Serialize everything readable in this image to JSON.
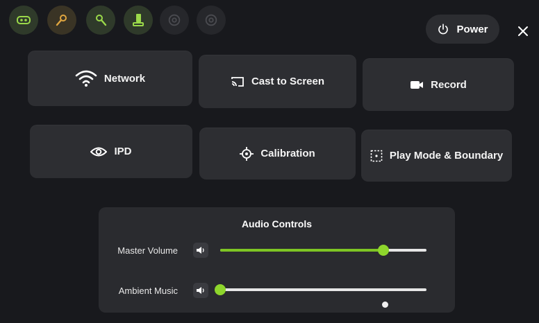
{
  "status_bar": {
    "icons": [
      {
        "name": "headset-icon",
        "state": "active"
      },
      {
        "name": "controller-left-icon",
        "state": "active"
      },
      {
        "name": "controller-right-icon",
        "state": "active"
      },
      {
        "name": "device-icon",
        "state": "active"
      },
      {
        "name": "tracker-icon",
        "state": "inactive"
      },
      {
        "name": "tracker-icon",
        "state": "inactive"
      }
    ]
  },
  "header": {
    "power_label": "Power",
    "power_icon": "power-icon",
    "close_icon": "close-icon"
  },
  "tiles": [
    {
      "label": "Network",
      "icon": "wifi-icon"
    },
    {
      "label": "Cast to Screen",
      "icon": "cast-icon"
    },
    {
      "label": "Record",
      "icon": "record-icon"
    },
    {
      "label": "IPD",
      "icon": "eye-icon"
    },
    {
      "label": "Calibration",
      "icon": "crosshair-icon"
    },
    {
      "label": "Play Mode & Boundary",
      "icon": "boundary-icon"
    }
  ],
  "audio": {
    "title": "Audio Controls",
    "sliders": [
      {
        "label": "Master Volume",
        "value": 0.79
      },
      {
        "label": "Ambient Music",
        "value": 0.0
      }
    ]
  },
  "colors": {
    "accent": "#7ec524",
    "background": "#18191d",
    "tile": "#2d2e32"
  }
}
